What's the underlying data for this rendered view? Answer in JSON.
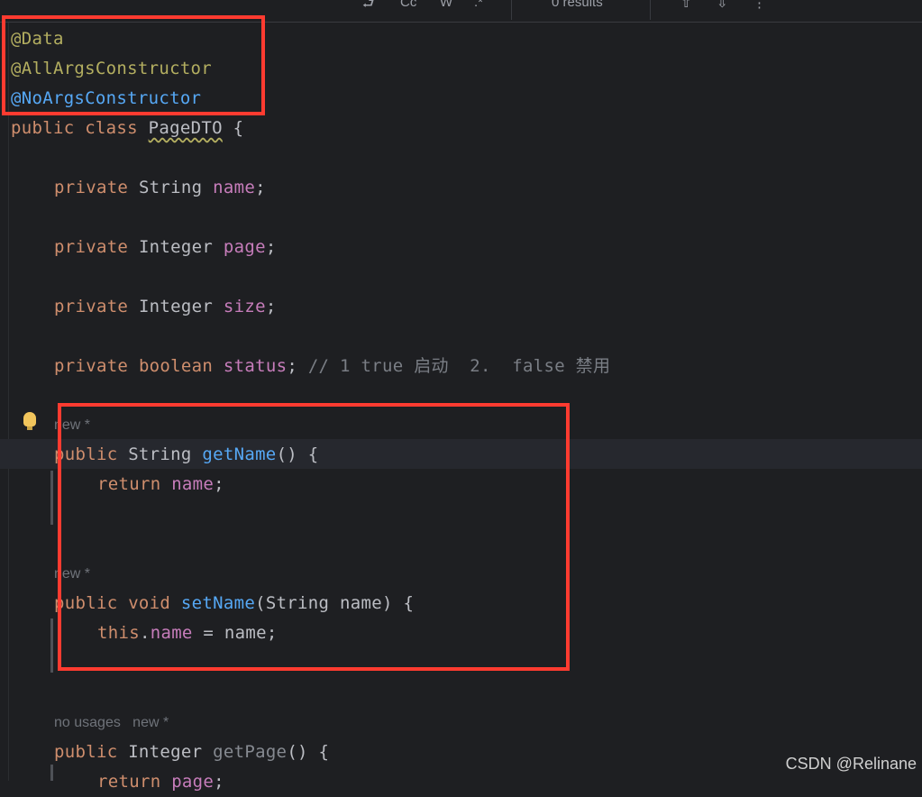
{
  "topbar": {
    "results": "0 results"
  },
  "code": {
    "annotations": [
      "@Data",
      "@AllArgsConstructor",
      "@NoArgsConstructor"
    ],
    "class_line": {
      "kw1": "public",
      "kw2": "class",
      "name": "PageDTO",
      "open": "{"
    },
    "fields": [
      {
        "mod": "private",
        "type": "String",
        "name": "name",
        "end": ";"
      },
      {
        "mod": "private",
        "type": "Integer",
        "name": "page",
        "end": ";"
      },
      {
        "mod": "private",
        "type": "Integer",
        "name": "size",
        "end": ";"
      },
      {
        "mod": "private",
        "type": "boolean",
        "name": "status",
        "end": ";",
        "comment": "// 1 true 启动  2.  false 禁用"
      }
    ],
    "methods": [
      {
        "hint": "new *",
        "sig_kw": "public",
        "sig_type": "String",
        "sig_name": "getName",
        "sig_rest": "() {",
        "body_kw": "return",
        "body_rest": "name",
        "body_end": ";"
      },
      {
        "hint": "new *",
        "sig_kw": "public",
        "sig_type": "void",
        "sig_name": "setName",
        "sig_rest": "(String name) {",
        "body_kw": "this",
        "body_field": "name",
        "body_rest": " = name;"
      },
      {
        "hint": "no usages   new *",
        "sig_kw": "public",
        "sig_type": "Integer",
        "sig_name": "getPage",
        "sig_rest": "() {",
        "body_kw": "return",
        "body_rest": "page",
        "body_end": ";"
      }
    ]
  },
  "watermark": "CSDN @Relinane",
  "colors": {
    "highlight_box": "#ff3b30",
    "bulb": "#f2c55c"
  }
}
